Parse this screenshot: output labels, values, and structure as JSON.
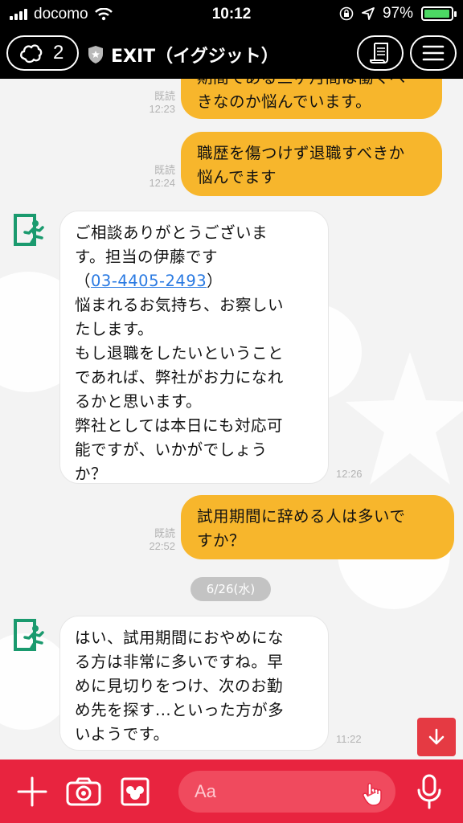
{
  "status": {
    "carrier": "docomo",
    "time": "10:12",
    "battery": "97%",
    "battery_level": 0.97
  },
  "header": {
    "friend_count": "2",
    "title": "EXIT（イグジット）"
  },
  "messages": [
    {
      "side": "out",
      "read": "既読",
      "time": "12:23",
      "lines": [
        "期間である三ヶ月間は働くべ",
        "きなのか悩んでいます。"
      ]
    },
    {
      "side": "out",
      "read": "既読",
      "time": "12:24",
      "lines": [
        "職歴を傷つけず退職すべきか",
        "悩んでます"
      ]
    },
    {
      "side": "in",
      "time": "12:26",
      "line1": "ご相談ありがとうございま",
      "line2": "す。担当の伊藤です",
      "phone_prefix": "（",
      "phone": "03-4405-2493",
      "phone_suffix": "）",
      "lines_after": [
        "悩まれるお気持ち、お察しい",
        "たします。",
        "もし退職をしたいということ",
        "であれば、弊社がお力になれ",
        "るかと思います。",
        "弊社としては本日にも対応可",
        "能ですが、いかがでしょう",
        "か？"
      ]
    },
    {
      "side": "out",
      "read": "既読",
      "time": "22:52",
      "lines": [
        "試用期間に辞める人は多いで",
        "すか？"
      ]
    },
    {
      "side": "in",
      "time": "11:22",
      "lines": [
        "はい、試用期間におやめにな",
        "る方は非常に多いですね。早",
        "めに見切りをつけ、次のお勤",
        "め先を探す...といった方が多",
        "いようです。"
      ]
    }
  ],
  "date_separator": "6/26(水)",
  "input": {
    "placeholder": "Aa"
  },
  "colors": {
    "accent": "#e8243f",
    "outgoing": "#f7b62c",
    "link": "#2a7ae2",
    "avatar": "#1a9a6e"
  },
  "icons": [
    "wifi-icon",
    "lock-rotation-icon",
    "location-icon",
    "friends-icon",
    "shield-icon",
    "note-icon",
    "menu-icon",
    "exit-avatar-icon",
    "arrow-down-icon",
    "plus-icon",
    "camera-icon",
    "image-icon",
    "hand-icon",
    "mic-icon"
  ]
}
